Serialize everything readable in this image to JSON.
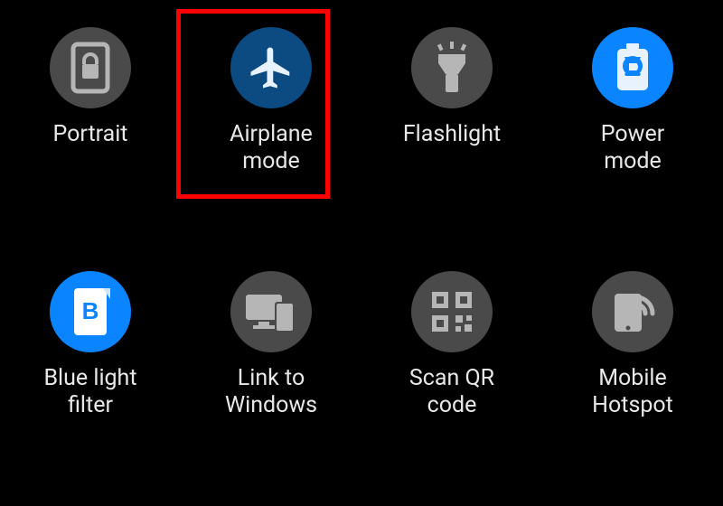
{
  "colors": {
    "bg": "#000000",
    "circle_off": "#4a4a4a",
    "circle_on": "#0a84ff",
    "circle_on_dim": "#0c4a82",
    "icon_off": "#b6b6b6",
    "icon_on": "#e8f2ff",
    "label": "#e8e8e8",
    "highlight": "#ff0000"
  },
  "grid": {
    "rows": 2,
    "cols": 4
  },
  "tiles": [
    {
      "id": "portrait",
      "icon": "portrait-lock-icon",
      "label": "Portrait",
      "state": "off"
    },
    {
      "id": "airplane",
      "icon": "airplane-icon",
      "label": "Airplane\nmode",
      "state": "on-dim"
    },
    {
      "id": "flashlight",
      "icon": "flashlight-icon",
      "label": "Flashlight",
      "state": "off"
    },
    {
      "id": "power",
      "icon": "power-mode-icon",
      "label": "Power\nmode",
      "state": "on"
    },
    {
      "id": "bluelight",
      "icon": "blue-light-filter-icon",
      "label": "Blue light\nfilter",
      "state": "on"
    },
    {
      "id": "linkwin",
      "icon": "link-to-windows-icon",
      "label": "Link to\nWindows",
      "state": "off"
    },
    {
      "id": "qr",
      "icon": "qr-code-icon",
      "label": "Scan QR\ncode",
      "state": "off"
    },
    {
      "id": "hotspot",
      "icon": "hotspot-icon",
      "label": "Mobile\nHotspot",
      "state": "off"
    }
  ],
  "highlight": {
    "target": "airplane"
  }
}
